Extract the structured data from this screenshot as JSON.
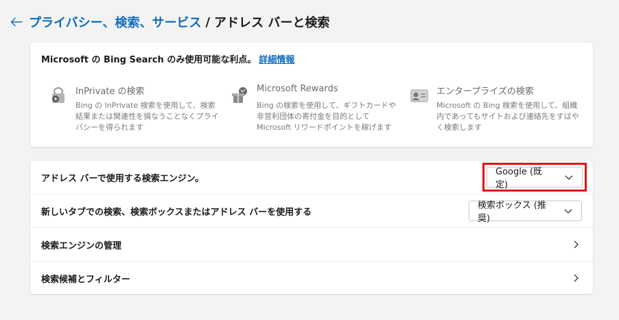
{
  "breadcrumb": {
    "parent": "プライバシー、検索、サービス",
    "separator": "/",
    "current": "アドレス バーと検索"
  },
  "bing": {
    "heading": "Microsoft の Bing Search のみ使用可能な利点。",
    "link": "詳細情報",
    "benefits": [
      {
        "icon": "inprivate-lock-icon",
        "title": "InPrivate の検索",
        "desc": "Bing の InPrivate 検索を使用して、検索結果または関連性を損なうことなくプライバシーを得られます"
      },
      {
        "icon": "rewards-trophy-icon",
        "title": "Microsoft Rewards",
        "desc": "Bing の検索を使用して、ギフトカードや非営利団体の寄付金を目的として Microsoft リワードポイントを稼げます"
      },
      {
        "icon": "enterprise-id-card-icon",
        "title": "エンタープライズの検索",
        "desc": "Microsoft の Bing 検索を使用して、組織内であってもサイトおよび連絡先をすばやく検索します"
      }
    ]
  },
  "settings": {
    "engine_label": "アドレス バーで使用する検索エンジン。",
    "engine_value": "Google (既定)",
    "newtab_label": "新しいタブでの検索、検索ボックスまたはアドレス バーを使用する",
    "newtab_value": "検索ボックス (推奨)",
    "manage_label": "検索エンジンの管理",
    "suggest_label": "検索候補とフィルター"
  },
  "colors": {
    "accent": "#0f6cbd",
    "highlight": "#e01414"
  }
}
